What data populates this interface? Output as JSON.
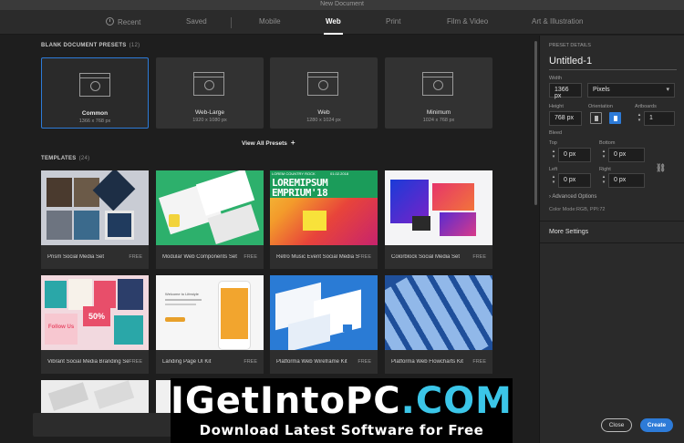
{
  "window": {
    "title": "New Document"
  },
  "tabs": [
    {
      "label": "Recent"
    },
    {
      "label": "Saved"
    },
    {
      "label": "Mobile"
    },
    {
      "label": "Web"
    },
    {
      "label": "Print"
    },
    {
      "label": "Film & Video"
    },
    {
      "label": "Art & Illustration"
    }
  ],
  "active_tab": "Web",
  "blank_presets": {
    "heading": "BLANK DOCUMENT PRESETS",
    "count": "(12)",
    "items": [
      {
        "name": "Common",
        "dims": "1366 x 768 px",
        "selected": true
      },
      {
        "name": "Web-Large",
        "dims": "1920 x 1080 px",
        "selected": false
      },
      {
        "name": "Web",
        "dims": "1280 x 1024 px",
        "selected": false
      },
      {
        "name": "Minimum",
        "dims": "1024 x 768 px",
        "selected": false
      }
    ],
    "view_all": "View All Presets",
    "view_all_icon": "+"
  },
  "templates": {
    "heading": "TEMPLATES",
    "count": "(24)",
    "items": [
      {
        "name": "Prism Social Media Set",
        "badge": "FREE"
      },
      {
        "name": "Modular Web Components Set",
        "badge": "FREE"
      },
      {
        "name": "Retro Music Event Social Media Set",
        "badge": "FREE",
        "thumb_text": [
          "LOREMIPSUM",
          "EMPRIUM'18",
          "LOREM COUNTRY ROCK",
          "01.02.2018"
        ]
      },
      {
        "name": "Colorblock Social Media Set",
        "badge": "FREE"
      },
      {
        "name": "Vibrant Social Media Branding Set",
        "badge": "FREE",
        "thumb_text": [
          "50%",
          "Follow Us"
        ]
      },
      {
        "name": "Landing Page UI Kit",
        "badge": "FREE",
        "thumb_text": [
          "Welcome to Lifestyle"
        ]
      },
      {
        "name": "Platforma Web Wireframe Kit",
        "badge": "FREE"
      },
      {
        "name": "Platforma Web Flowcharts Kit",
        "badge": "FREE"
      }
    ]
  },
  "preset_details": {
    "heading": "PRESET DETAILS",
    "doc_name": "Untitled-1",
    "width_label": "Width",
    "width_value": "1366 px",
    "units_value": "Pixels",
    "height_label": "Height",
    "height_value": "768 px",
    "orientation_label": "Orientation",
    "orientation_selected": "landscape",
    "artboards_label": "Artboards",
    "artboards_value": "1",
    "bleed_label": "Bleed",
    "top_label": "Top",
    "top_value": "0 px",
    "bottom_label": "Bottom",
    "bottom_value": "0 px",
    "left_label": "Left",
    "left_value": "0 px",
    "right_label": "Right",
    "right_value": "0 px",
    "advanced_options": "Advanced Options",
    "advanced_icon": "chevron-right-icon",
    "color_mode": "Color Mode:RGB, PPI:72",
    "more_settings": "More Settings"
  },
  "buttons": {
    "close": "Close",
    "create": "Create"
  },
  "colors": {
    "accent": "#2d7bd8",
    "background": "#1e1e1e",
    "panel": "#2a2a2a"
  },
  "watermark": {
    "main_part1": "IGetIntoPC",
    "main_dot": ".",
    "main_part2": "COM",
    "sub": "Download Latest Software for Free"
  }
}
